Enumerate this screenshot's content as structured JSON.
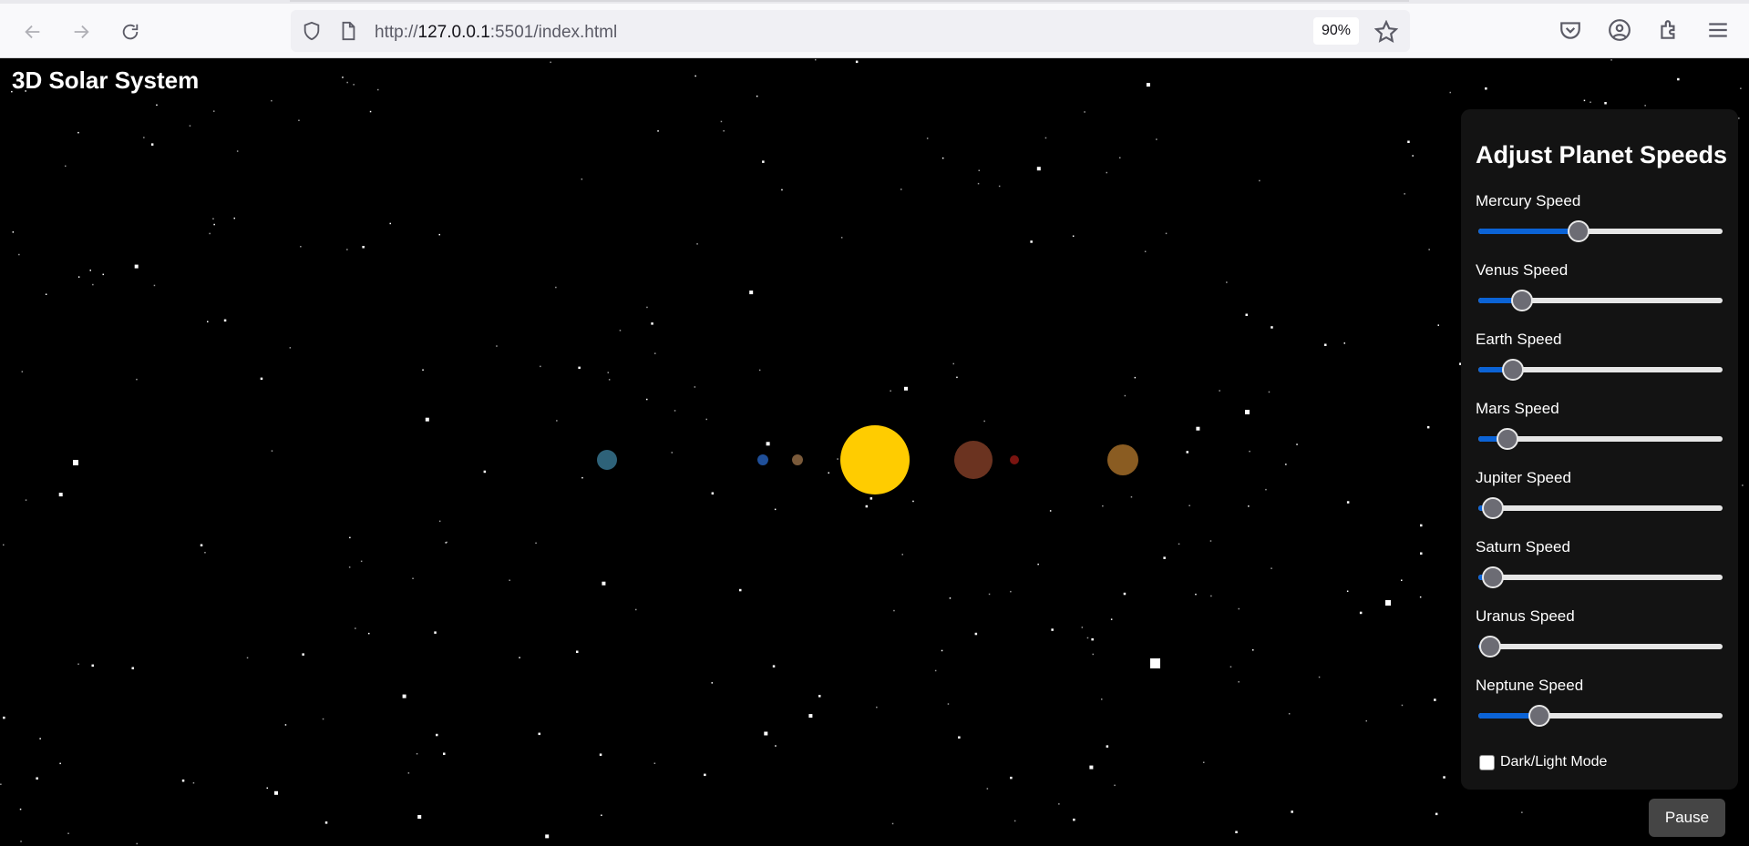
{
  "browser": {
    "url_prefix": "http://",
    "url_host": "127.0.0.1",
    "url_rest": ":5501/index.html",
    "zoom": "90%",
    "icons": [
      "back-arrow-icon",
      "forward-arrow-icon",
      "reload-icon",
      "shield-icon",
      "page-icon",
      "bookmark-star-icon",
      "pocket-icon",
      "account-icon",
      "extensions-icon",
      "menu-icon"
    ]
  },
  "page": {
    "title": "3D Solar System"
  },
  "panel": {
    "heading": "Adjust Planet Speeds",
    "controls": [
      {
        "label": "Mercury Speed",
        "value": 0.41
      },
      {
        "label": "Venus Speed",
        "value": 0.18
      },
      {
        "label": "Earth Speed",
        "value": 0.14
      },
      {
        "label": "Mars Speed",
        "value": 0.12
      },
      {
        "label": "Jupiter Speed",
        "value": 0.06
      },
      {
        "label": "Saturn Speed",
        "value": 0.06
      },
      {
        "label": "Uranus Speed",
        "value": 0.05
      },
      {
        "label": "Neptune Speed",
        "value": 0.25
      }
    ],
    "mode_label": "Dark/Light Mode",
    "mode_checked": false
  },
  "pause_label": "Pause",
  "colors": {
    "sun": "#ffcc00",
    "slider_fill": "#0b63d6",
    "background": "#000000"
  }
}
